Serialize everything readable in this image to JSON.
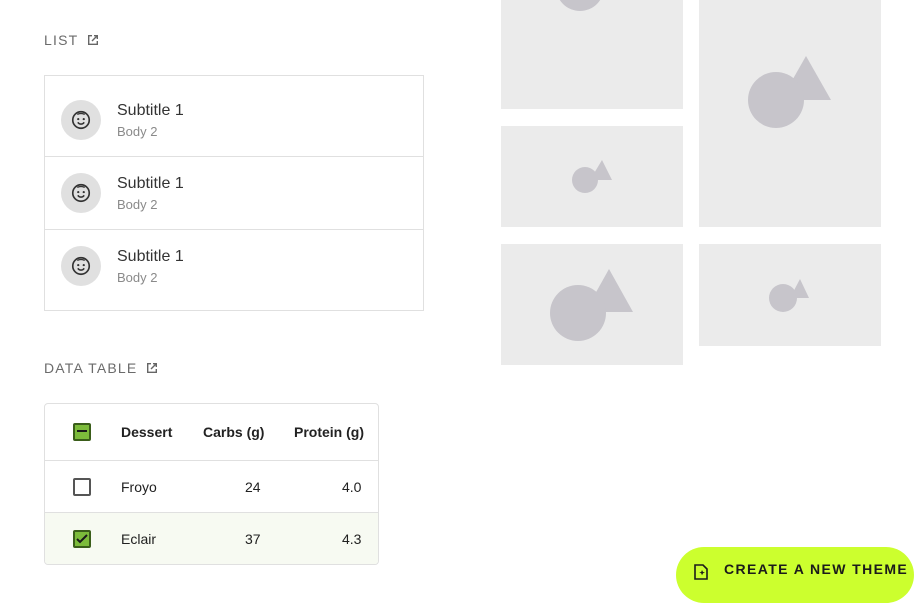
{
  "list_section": {
    "title": "LIST",
    "items": [
      {
        "subtitle": "Subtitle 1",
        "body": "Body 2"
      },
      {
        "subtitle": "Subtitle 1",
        "body": "Body 2"
      },
      {
        "subtitle": "Subtitle 1",
        "body": "Body 2"
      }
    ]
  },
  "table_section": {
    "title": "DATA TABLE",
    "columns": [
      "Dessert",
      "Carbs (g)",
      "Protein (g)"
    ],
    "rows": [
      {
        "dessert": "Froyo",
        "carbs": "24",
        "protein": "4.0",
        "checked": false
      },
      {
        "dessert": "Eclair",
        "carbs": "37",
        "protein": "4.3",
        "checked": true
      }
    ],
    "header_checkbox_state": "indeterminate"
  },
  "fab": {
    "label": "CREATE A NEW THEME",
    "icon": "theme-edit-icon"
  },
  "colors": {
    "accent": "#ccff2e",
    "checkbox_green": "#7cbb3b",
    "placeholder_tile": "#ebebeb",
    "placeholder_shape": "#c7c5cb"
  }
}
